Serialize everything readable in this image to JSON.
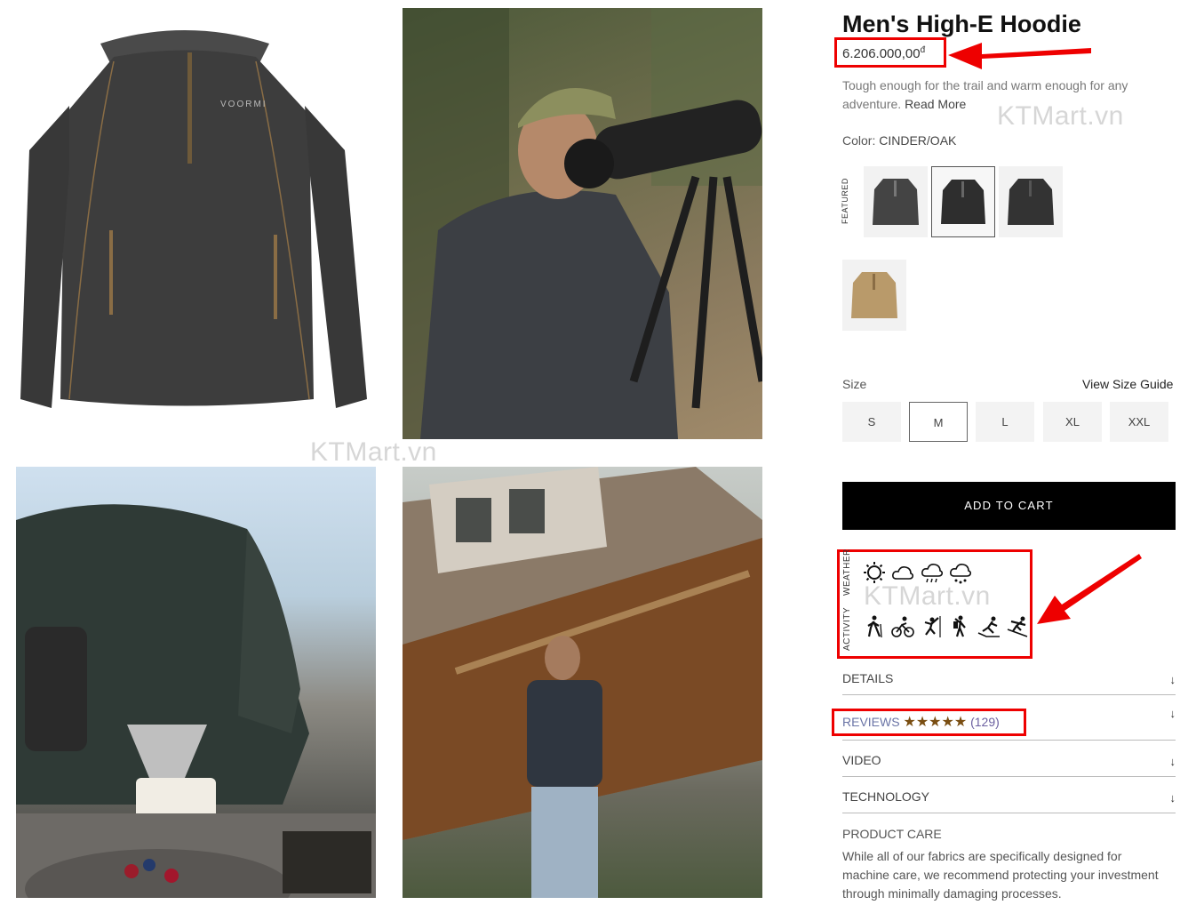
{
  "product": {
    "title": "Men's High-E Hoodie",
    "price": "6.206.000,00",
    "currency_symbol": "đ",
    "description": "Tough enough for the trail and warm enough for any adventure.",
    "read_more": "Read More",
    "color_label": "Color:",
    "color_value": "CINDER/OAK",
    "featured_label": "FEATURED"
  },
  "sizes": {
    "label": "Size",
    "guide": "View Size Guide",
    "options": [
      "S",
      "M",
      "L",
      "XL",
      "XXL"
    ],
    "selected": "M"
  },
  "cart": {
    "label": "ADD TO CART"
  },
  "conditions": {
    "weather_label": "WEATHER",
    "activity_label": "ACTIVITY",
    "weather_icons": [
      "sun-icon",
      "cloud-icon",
      "cloud-rain-icon",
      "cloud-snow-icon"
    ],
    "activity_icons": [
      "hiking-icon",
      "cycling-icon",
      "climbing-icon",
      "mountaineering-icon",
      "snowshoe-icon",
      "skiing-icon"
    ]
  },
  "accordion": {
    "details": "DETAILS",
    "reviews": "REVIEWS",
    "reviews_stars": "★★★★★",
    "reviews_count": "(129)",
    "video": "VIDEO",
    "technology": "TECHNOLOGY",
    "care_title": "PRODUCT CARE",
    "care_text": "While all of our fabrics are specifically designed for machine care, we recommend protecting your investment through minimally damaging processes."
  },
  "watermark": "KTMart.vn",
  "gallery_brand": "VOORMI",
  "colors": {
    "accent_red": "#e00000",
    "cart_bg": "#000000",
    "star_color": "#7a4e12"
  }
}
